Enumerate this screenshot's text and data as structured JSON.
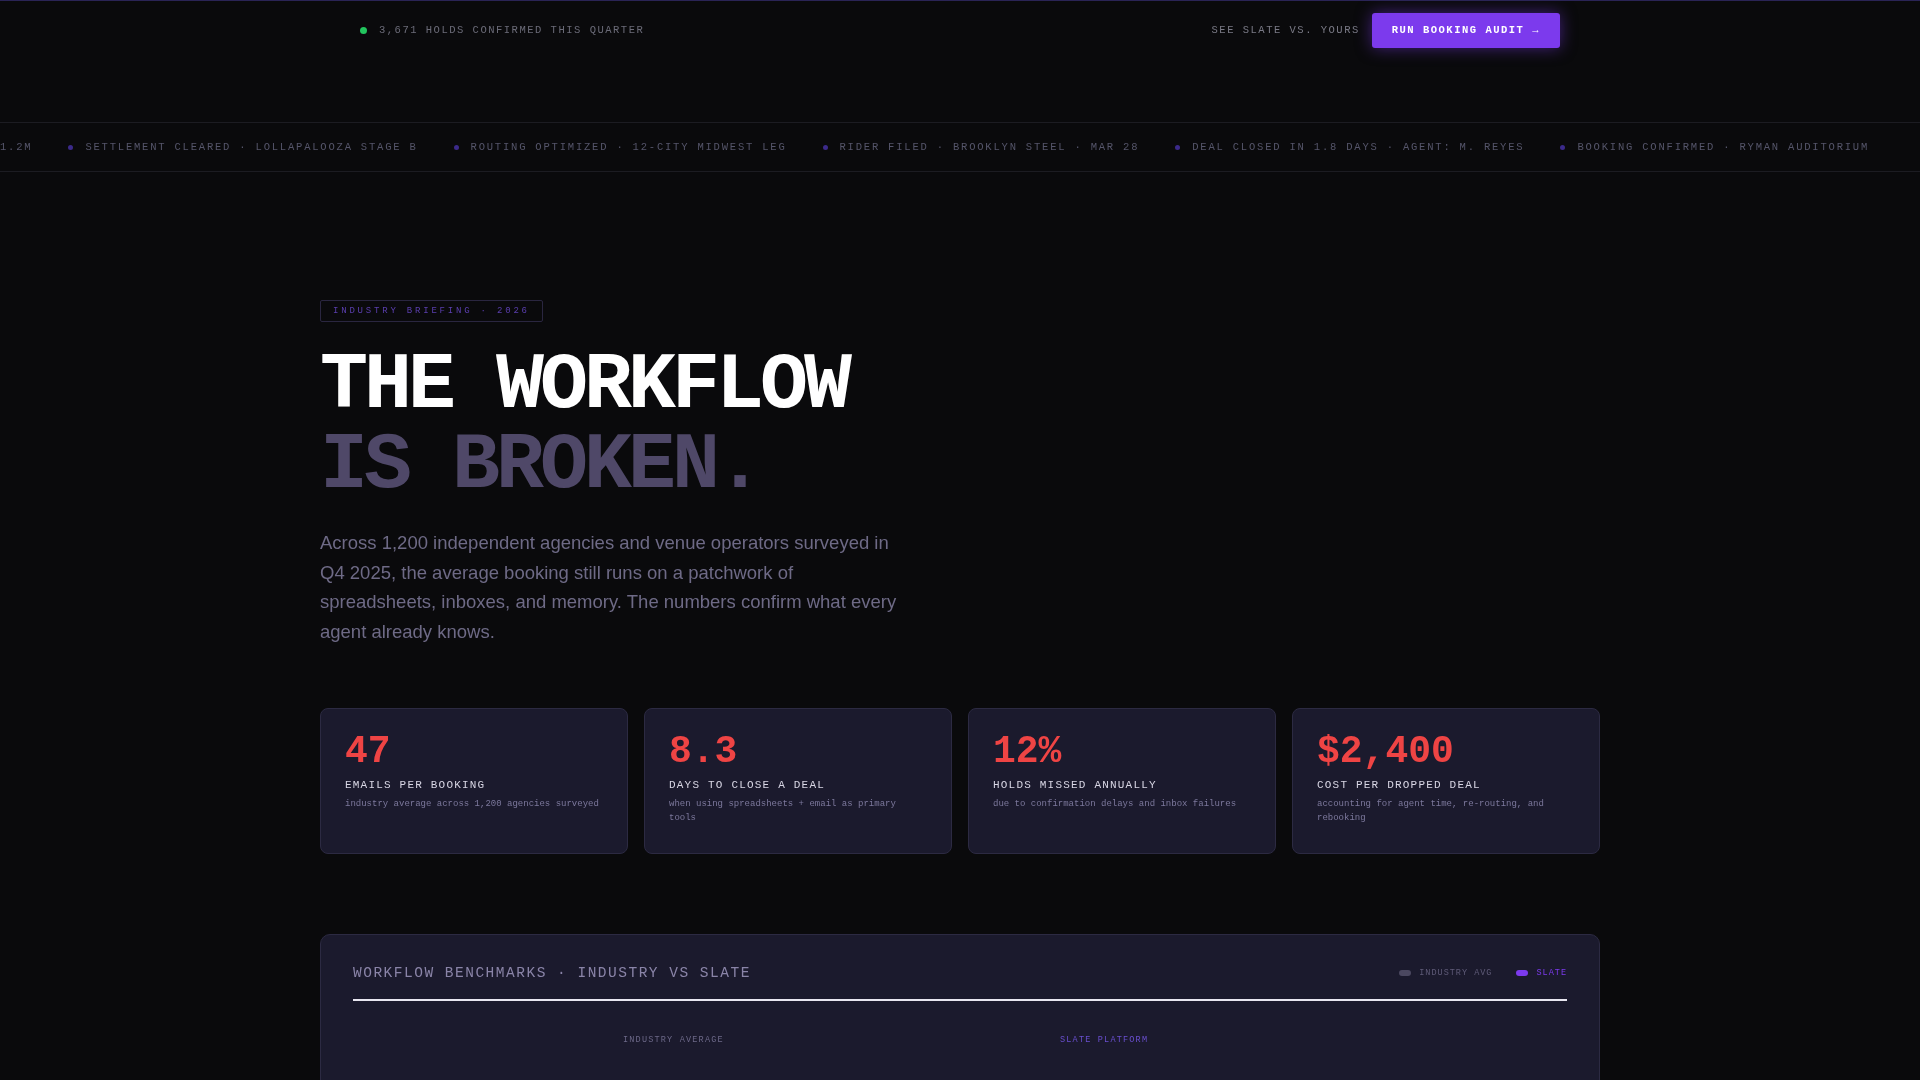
{
  "top_bar": {
    "status": "3,671 HOLDS CONFIRMED THIS QUARTER",
    "link": "SEE SLATE VS. YOURS",
    "cta": "RUN BOOKING AUDIT →"
  },
  "ticker": [
    {
      "text": "1.2M",
      "marked": false
    },
    {
      "text": "SETTLEMENT CLEARED · LOLLAPALOOZA STAGE B",
      "marked": true
    },
    {
      "text": "ROUTING OPTIMIZED · 12-CITY MIDWEST LEG",
      "marked": true
    },
    {
      "text": "RIDER FILED · BROOKLYN STEEL · MAR 28",
      "marked": true
    },
    {
      "text": "DEAL CLOSED IN 1.8 DAYS · AGENT: M. REYES",
      "marked": true
    },
    {
      "text": "BOOKING CONFIRMED · RYMAN AUDITORIUM",
      "marked": true
    }
  ],
  "hero": {
    "badge": "INDUSTRY BRIEFING · 2026",
    "title_line_1": "THE WORKFLOW",
    "title_line_2": "IS BROKEN.",
    "intro": "Across 1,200 independent agencies and venue operators surveyed in Q4 2025, the average booking still runs on a patchwork of spreadsheets, inboxes, and memory. The numbers confirm what every agent already knows."
  },
  "stats": [
    {
      "value": "47",
      "label": "EMAILS PER BOOKING",
      "note": "industry average across 1,200 agencies surveyed"
    },
    {
      "value": "8.3",
      "label": "DAYS TO CLOSE A DEAL",
      "note": "when using spreadsheets + email as primary tools"
    },
    {
      "value": "12%",
      "label": "HOLDS MISSED ANNUALLY",
      "note": "due to confirmation delays and inbox failures"
    },
    {
      "value": "$2,400",
      "label": "COST PER DROPPED DEAL",
      "note": "accounting for agent time, re-routing, and rebooking"
    }
  ],
  "benchmarks": {
    "title": "WORKFLOW BENCHMARKS · INDUSTRY VS SLATE",
    "legend": [
      {
        "label": "INDUSTRY AVG",
        "color": "#4b4860"
      },
      {
        "label": "SLATE",
        "color": "#7c3aed"
      }
    ],
    "columns": [
      {
        "label": "INDUSTRY AVERAGE",
        "kind": "industry"
      },
      {
        "label": "SLATE PLATFORM",
        "kind": "slate"
      }
    ]
  }
}
